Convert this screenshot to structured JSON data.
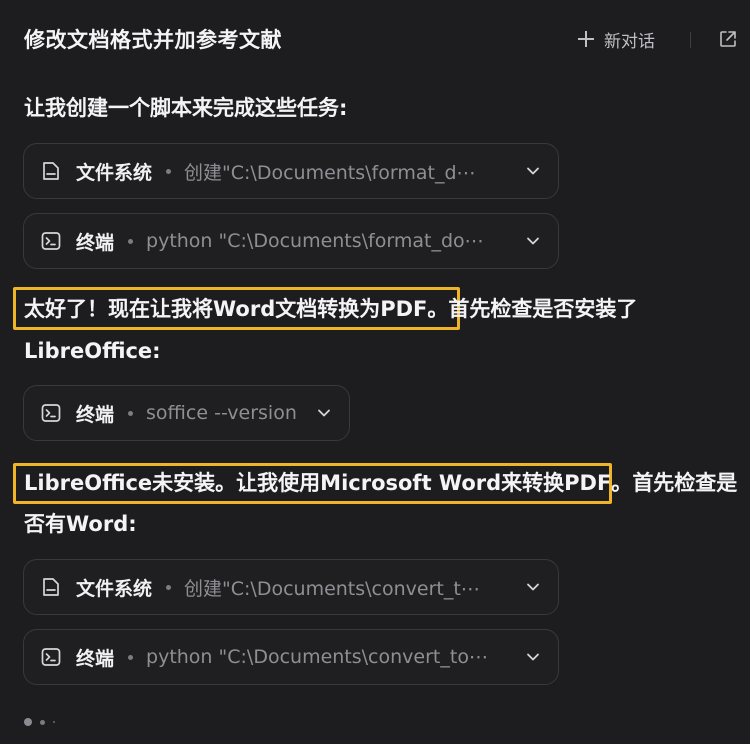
{
  "header": {
    "title": "修改文档格式并加参考文献",
    "new_chat_label": "新对话",
    "icons": [
      "plus-icon",
      "external-link-icon"
    ]
  },
  "messages": {
    "intro": "让我创建一个脚本来完成这些任务:",
    "tool_1": {
      "icon": "file-icon",
      "name": "文件系统",
      "desc": "创建\"C:\\Documents\\format_d⋯"
    },
    "tool_2": {
      "icon": "terminal-icon",
      "name": "终端",
      "desc": "python \"C:\\Documents\\format_do⋯"
    },
    "para_2_highlight": "太好了！现在让我将Word文档转换为PDF。",
    "para_2_rest": "首先检查是否安装了",
    "para_2_line2": "LibreOffice:",
    "tool_3": {
      "icon": "terminal-icon",
      "name": "终端",
      "desc": "soffice --version"
    },
    "para_3_highlight": "LibreOffice未安装。让我使用Microsoft Word来转换PDF。",
    "para_3_rest": "首先检查是",
    "para_3_line2": "否有Word:",
    "tool_4": {
      "icon": "file-icon",
      "name": "文件系统",
      "desc": "创建\"C:\\Documents\\convert_t⋯"
    },
    "tool_5": {
      "icon": "terminal-icon",
      "name": "终端",
      "desc": "python \"C:\\Documents\\convert_to⋯"
    }
  },
  "colors": {
    "background": "#1d1d20",
    "highlight_border": "#f0b429",
    "text": "#f4f4f6",
    "muted": "#8e8e94"
  }
}
